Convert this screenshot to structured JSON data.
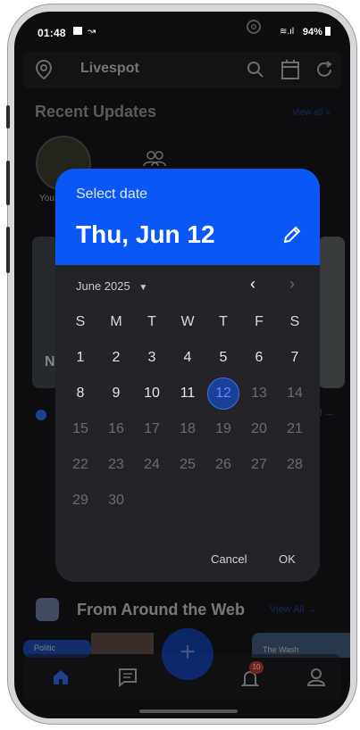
{
  "status_bar": {
    "time": "01:48",
    "right": "94%",
    "signal_icon": "wifi-signal-icon",
    "battery_icon": "battery-icon"
  },
  "app_bar": {
    "title": "Livespot"
  },
  "recent_updates": {
    "title": "Recent Updates",
    "view_all": "View all >",
    "story_label": "You"
  },
  "content_letter": "N",
  "from_web": {
    "title": "From Around the Web",
    "view_all": "View All →",
    "card_left_label": "Politic",
    "card_right_label": "The Wash"
  },
  "date_picker": {
    "header_label": "Select date",
    "selected_date": "Thu, Jun 12",
    "month_label": "June 2025",
    "weekdays": [
      "S",
      "M",
      "T",
      "W",
      "T",
      "F",
      "S"
    ],
    "days": [
      "1",
      "2",
      "3",
      "4",
      "5",
      "6",
      "7",
      "8",
      "9",
      "10",
      "11",
      "12",
      "13",
      "14",
      "15",
      "16",
      "17",
      "18",
      "19",
      "20",
      "21",
      "22",
      "23",
      "24",
      "25",
      "26",
      "27",
      "28",
      "29",
      "30"
    ],
    "selected_day": 12,
    "cancel_label": "Cancel",
    "ok_label": "OK"
  },
  "bottom_nav": {
    "notification_badge": "10"
  },
  "colors": {
    "accent": "#0b57f5",
    "background": "#0d0d0f",
    "dialog": "#242428"
  }
}
